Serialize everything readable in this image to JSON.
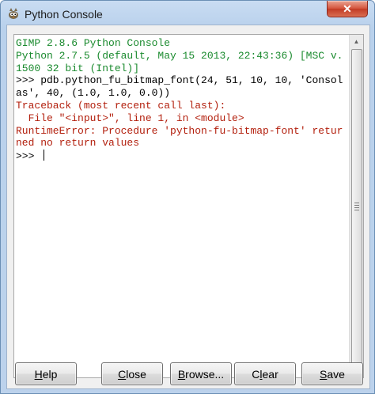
{
  "window": {
    "title": "Python Console",
    "close_label": "✕"
  },
  "console": {
    "lines": [
      {
        "text": "GIMP 2.8.6 Python Console",
        "color": "green"
      },
      {
        "text": "Python 2.7.5 (default, May 15 2013, 22:43:36) [MSC v.1500 32 bit (Intel)]",
        "color": "green"
      },
      {
        "text": ">>> pdb.python_fu_bitmap_font(24, 51, 10, 10, 'Consolas', 40, (1.0, 1.0, 0.0))",
        "color": "black"
      },
      {
        "text": "Traceback (most recent call last):",
        "color": "red"
      },
      {
        "text": "  File \"<input>\", line 1, in <module>",
        "color": "red"
      },
      {
        "text": "RuntimeError: Procedure 'python-fu-bitmap-font' returned no return values",
        "color": "red"
      }
    ],
    "prompt": ">>> "
  },
  "colors": {
    "green": "#1a8a2e",
    "red": "#b3200e",
    "black": "#000000"
  },
  "buttons": {
    "help": {
      "pre": "",
      "key": "H",
      "post": "elp"
    },
    "close": {
      "pre": "",
      "key": "C",
      "post": "lose"
    },
    "browse": {
      "pre": "",
      "key": "B",
      "post": "rowse..."
    },
    "clear": {
      "pre": "C",
      "key": "l",
      "post": "ear"
    },
    "save": {
      "pre": "",
      "key": "S",
      "post": "ave"
    }
  },
  "icons": {
    "app": "gimp-wilber-icon",
    "scroll_up": "chevron-up-icon",
    "scroll_down": "chevron-down-icon"
  }
}
